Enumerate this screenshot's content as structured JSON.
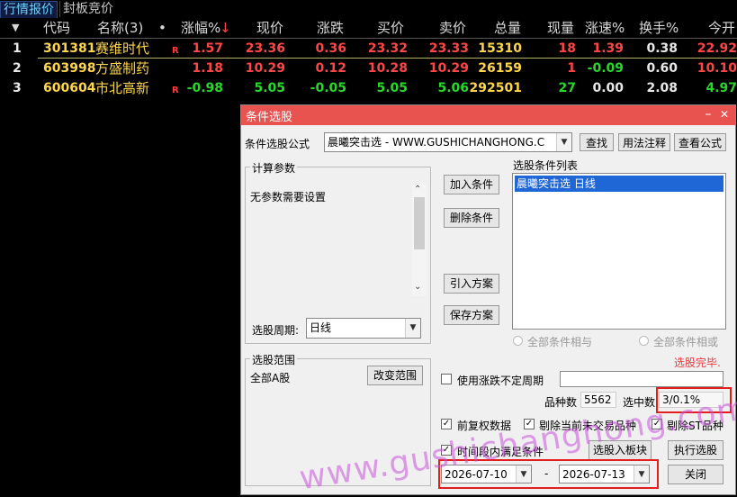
{
  "tabs": {
    "quotes": "行情报价",
    "limit_auction": "封板竞价"
  },
  "columns": {
    "dropdown": "▼",
    "code": "代码",
    "name": "名称(3)",
    "dot": "•",
    "change_pct": "涨幅%",
    "sort_arrow": "↓",
    "price": "现价",
    "change": "涨跌",
    "bid": "买价",
    "ask": "卖价",
    "volume": "总量",
    "cur_volume": "现量",
    "speed": "涨速%",
    "turnover": "换手%",
    "open": "今开"
  },
  "rows": [
    {
      "idx": "1",
      "code": "301381",
      "name": "赛维时代",
      "flag": "R",
      "change_pct": "1.57",
      "price": "23.36",
      "change": "0.36",
      "bid": "23.32",
      "ask": "23.33",
      "volume": "15310",
      "cur_volume": "18",
      "speed": "1.39",
      "turnover": "0.38",
      "open": "22.92"
    },
    {
      "idx": "2",
      "code": "603998",
      "name": "方盛制药",
      "flag": "",
      "change_pct": "1.18",
      "price": "10.29",
      "change": "0.12",
      "bid": "10.28",
      "ask": "10.29",
      "volume": "26159",
      "cur_volume": "1",
      "speed": "-0.09",
      "turnover": "0.60",
      "open": "10.10"
    },
    {
      "idx": "3",
      "code": "600604",
      "name": "市北高新",
      "flag": "R",
      "change_pct": "-0.98",
      "price": "5.05",
      "change": "-0.05",
      "bid": "5.05",
      "ask": "5.06",
      "volume": "292501",
      "cur_volume": "27",
      "speed": "0.00",
      "turnover": "2.08",
      "open": "4.97"
    }
  ],
  "dialog": {
    "title": "条件选股",
    "minimize": "–",
    "close_x": "✕",
    "formula_label": "条件选股公式",
    "formula_value": "晨曦突击选  -  WWW.GUSHICHANGHONG.C",
    "find_btn": "查找",
    "usage_btn": "用法注释",
    "view_btn": "查看公式",
    "params_title": "计算参数",
    "params_text": "无参数需要设置",
    "period_label": "选股周期:",
    "period_value": "日线",
    "list_title": "选股条件列表",
    "list_item": "晨曦突击选  日线",
    "add_btn": "加入条件",
    "del_btn": "删除条件",
    "import_btn": "引入方案",
    "save_btn": "保存方案",
    "radio_and": "全部条件相与",
    "radio_or": "全部条件相或",
    "done": "选股完毕.",
    "range_title": "选股范围",
    "range_value": "全部A股",
    "change_range_btn": "改变范围",
    "variable_period": "使用涨跌不定周期",
    "count_label": "品种数",
    "count_value": "5562",
    "selected_label": "选中数",
    "selected_value": "3/0.1%",
    "restore_rights": "前复权数据",
    "exclude_untraded": "剔除当前未交易品种",
    "exclude_st": "剔除ST品种",
    "time_period": "时间段内满足条件",
    "to_block_btn": "选股入板块",
    "run_btn": "执行选股",
    "date_from": "2026-07-10",
    "date_sep": "-",
    "date_to": "2026-07-13",
    "close_btn": "关闭"
  },
  "watermark": "www.gushichanghong.com",
  "colors": {
    "up": "#ff4545",
    "down": "#27d927",
    "title_bar": "#e8534f",
    "highlight": "#e21e1e"
  }
}
